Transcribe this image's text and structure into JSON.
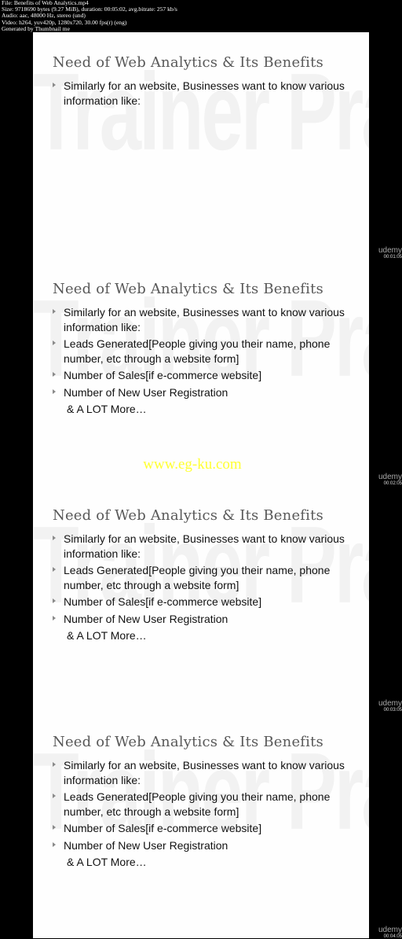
{
  "file_info": {
    "file": "File: Benefits of Web Analytics.mp4",
    "size": "Size: 9718690 bytes (9.27 MiB), duration: 00:05:02, avg.bitrate: 257 kb/s",
    "audio": "Audio: aac, 48000 Hz, stereo (und)",
    "video": "Video: h264, yuv420p, 1280x720, 30.00 fps(r) (eng)",
    "generator": "Generated by Thumbnail me"
  },
  "watermark": "Trainer Pranav Parekh",
  "site_watermark": "www.eg-ku.com",
  "frames": [
    {
      "title": "Need of Web Analytics & Its Benefits",
      "bullets": [
        "Similarly for an website, Businesses want to know various information like:"
      ],
      "more": "",
      "brand": "udemy",
      "timestamp": "00:01:05"
    },
    {
      "title": "Need of Web Analytics & Its Benefits",
      "bullets": [
        "Similarly for an website, Businesses want to know various information like:",
        "Leads Generated[People giving you their name, phone number, etc through a  website form]",
        "Number of Sales[if e-commerce website]",
        "Number of New User Registration"
      ],
      "more": "& A LOT More…",
      "brand": "udemy",
      "timestamp": "00:02:05"
    },
    {
      "title": "Need of Web Analytics & Its Benefits",
      "bullets": [
        "Similarly for an website, Businesses want to know various information like:",
        "Leads Generated[People giving you their name, phone number, etc through a  website form]",
        "Number of Sales[if e-commerce website]",
        "Number of New User Registration"
      ],
      "more": "& A LOT More…",
      "brand": "udemy",
      "timestamp": "00:03:05"
    },
    {
      "title": "Need of Web Analytics & Its Benefits",
      "bullets": [
        "Similarly for an website, Businesses want to know various information like:",
        "Leads Generated[People giving you their name, phone number, etc through a  website form]",
        "Number of Sales[if e-commerce website]",
        "Number of New User Registration"
      ],
      "more": "& A LOT More…",
      "brand": "udemy",
      "timestamp": "00:04:05"
    }
  ]
}
